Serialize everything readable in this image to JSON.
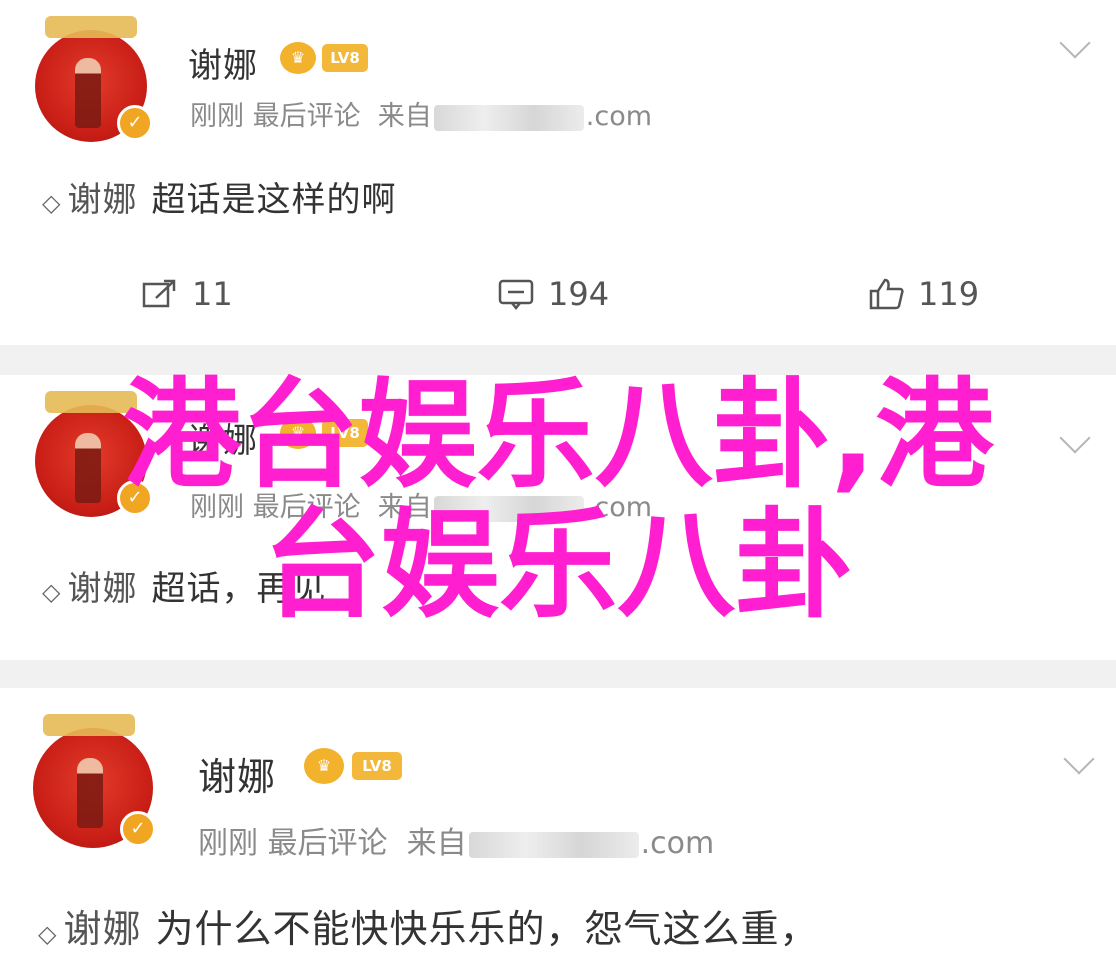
{
  "posts": [
    {
      "author": "谢娜",
      "lv_badge": "LV8",
      "meta_time": "刚刚",
      "meta_action": "最后评论",
      "meta_source_prefix": "来自",
      "meta_source_suffix": ".com",
      "topic_name": "谢娜",
      "content": "超话是这样的啊",
      "repost_count": "11",
      "comment_count": "194",
      "like_count": "119"
    },
    {
      "author": "谢娜",
      "lv_badge": "LV8",
      "meta_time": "刚刚",
      "meta_action": "最后评论",
      "meta_source_prefix": "来自",
      "meta_source_suffix": ".com",
      "topic_name": "谢娜",
      "content": "超话，再见"
    },
    {
      "author": "谢娜",
      "lv_badge": "LV8",
      "meta_time": "刚刚",
      "meta_action": "最后评论",
      "meta_source_prefix": "来自",
      "meta_source_suffix": ".com",
      "topic_name": "谢娜",
      "content": "为什么不能快快乐乐的，怨气这么重，"
    }
  ],
  "overlay": {
    "line1": "港台娱乐八卦,港",
    "line2": "台娱乐八卦"
  },
  "icons": {
    "verified": "✓",
    "supertopic": "◇",
    "crown": "♛",
    "chevron": "chevron-down-icon"
  },
  "colors": {
    "overlay": "#ff1fd0",
    "badge": "#f2b22c",
    "avatar": "#c81e16"
  }
}
